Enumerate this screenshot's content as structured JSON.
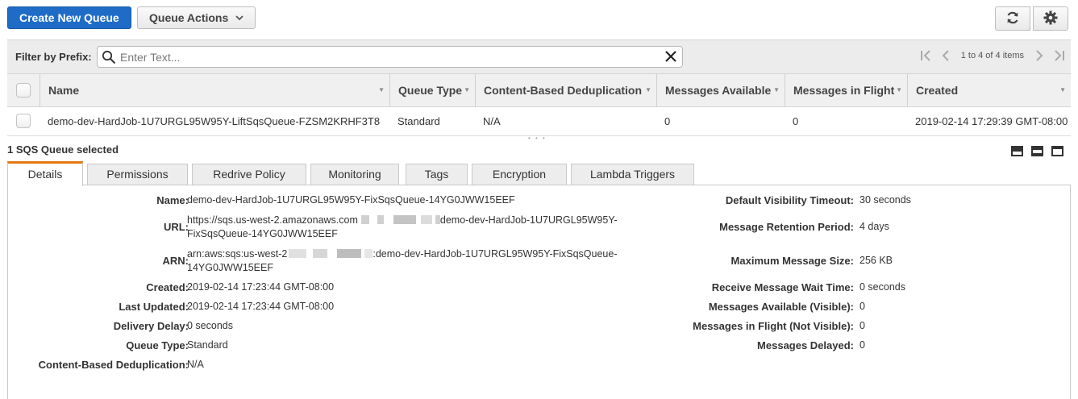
{
  "toolbar": {
    "create_label": "Create New Queue",
    "actions_label": "Queue Actions"
  },
  "filter": {
    "label": "Filter by Prefix:",
    "placeholder": "Enter Text...",
    "pager_text": "1 to 4 of 4 items"
  },
  "table": {
    "columns": [
      "Name",
      "Queue Type",
      "Content-Based Deduplication",
      "Messages Available",
      "Messages in Flight",
      "Created"
    ],
    "rows": [
      {
        "name": "demo-dev-HardJob-1U7URGL95W95Y-LiftSqsQueue-FZSM2KRHF3T8",
        "type": "Standard",
        "dedup": "N/A",
        "available": "0",
        "in_flight": "0",
        "created": "2019-02-14 17:29:39 GMT-08:00"
      }
    ]
  },
  "details": {
    "selected_text": "1 SQS Queue selected",
    "tabs": [
      "Details",
      "Permissions",
      "Redrive Policy",
      "Monitoring",
      "Tags",
      "Encryption",
      "Lambda Triggers"
    ],
    "active_tab": "Details",
    "left": {
      "name_label": "Name:",
      "name_value": "demo-dev-HardJob-1U7URGL95W95Y-FixSqsQueue-14YG0JWW15EEF",
      "url_label": "URL:",
      "url_line1_prefix": "https://sqs.us-west-2.amazonaws.com",
      "url_line1_suffix": "demo-dev-HardJob-1U7URGL95W95Y-",
      "url_line2": "FixSqsQueue-14YG0JWW15EEF",
      "arn_label": "ARN:",
      "arn_line1_prefix": "arn:aws:sqs:us-west-2",
      "arn_line1_suffix": ":demo-dev-HardJob-1U7URGL95W95Y-FixSqsQueue-",
      "arn_line2": "14YG0JWW15EEF",
      "created_label": "Created:",
      "created_value": "2019-02-14 17:23:44 GMT-08:00",
      "updated_label": "Last Updated:",
      "updated_value": "2019-02-14 17:23:44 GMT-08:00",
      "delay_label": "Delivery Delay:",
      "delay_value": "0 seconds",
      "type_label": "Queue Type:",
      "type_value": "Standard",
      "dedup_label": "Content-Based Deduplication:",
      "dedup_value": "N/A"
    },
    "right": {
      "visibility_label": "Default Visibility Timeout:",
      "visibility_value": "30 seconds",
      "retention_label": "Message Retention Period:",
      "retention_value": "4 days",
      "max_size_label": "Maximum Message Size:",
      "max_size_value": "256 KB",
      "wait_label": "Receive Message Wait Time:",
      "wait_value": "0 seconds",
      "available_label": "Messages Available (Visible):",
      "available_value": "0",
      "in_flight_label": "Messages in Flight (Not Visible):",
      "in_flight_value": "0",
      "delayed_label": "Messages Delayed:",
      "delayed_value": "0"
    }
  },
  "colors": {
    "primary": "#1f6cc7",
    "active_tab_accent": "#e47911"
  },
  "icons": [
    "refresh-icon",
    "gear-icon",
    "search-icon",
    "clear-icon",
    "first-page-icon",
    "prev-page-icon",
    "next-page-icon",
    "last-page-icon"
  ]
}
